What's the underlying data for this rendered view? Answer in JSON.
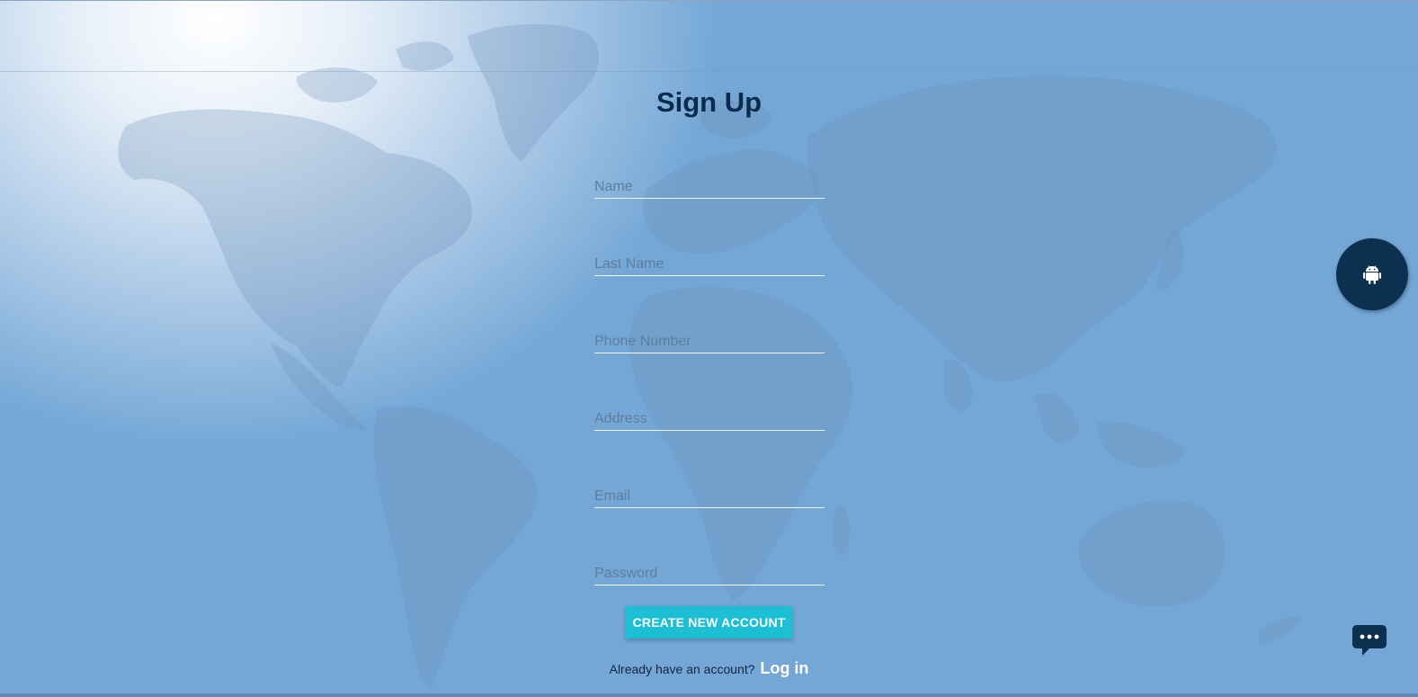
{
  "page": {
    "title": "Sign Up",
    "background_color": "#74a7d6"
  },
  "form": {
    "fields": [
      {
        "name": "name-input",
        "placeholder": "Name",
        "value": ""
      },
      {
        "name": "last-name-input",
        "placeholder": "Last Name",
        "value": ""
      },
      {
        "name": "phone-number-input",
        "placeholder": "Phone Number",
        "value": ""
      },
      {
        "name": "address-input",
        "placeholder": "Address",
        "value": ""
      },
      {
        "name": "email-input",
        "placeholder": "Email",
        "value": ""
      },
      {
        "name": "password-input",
        "placeholder": "Password",
        "value": ""
      }
    ],
    "submit_label": "CREATE NEW ACCOUNT",
    "submit_color": "#1dbfd4"
  },
  "login": {
    "prompt": "Already have an account?",
    "link_label": "Log in"
  },
  "floating": {
    "android_icon": "android-icon",
    "android_color": "#0d2f50",
    "chat_icon": "chat-icon"
  }
}
